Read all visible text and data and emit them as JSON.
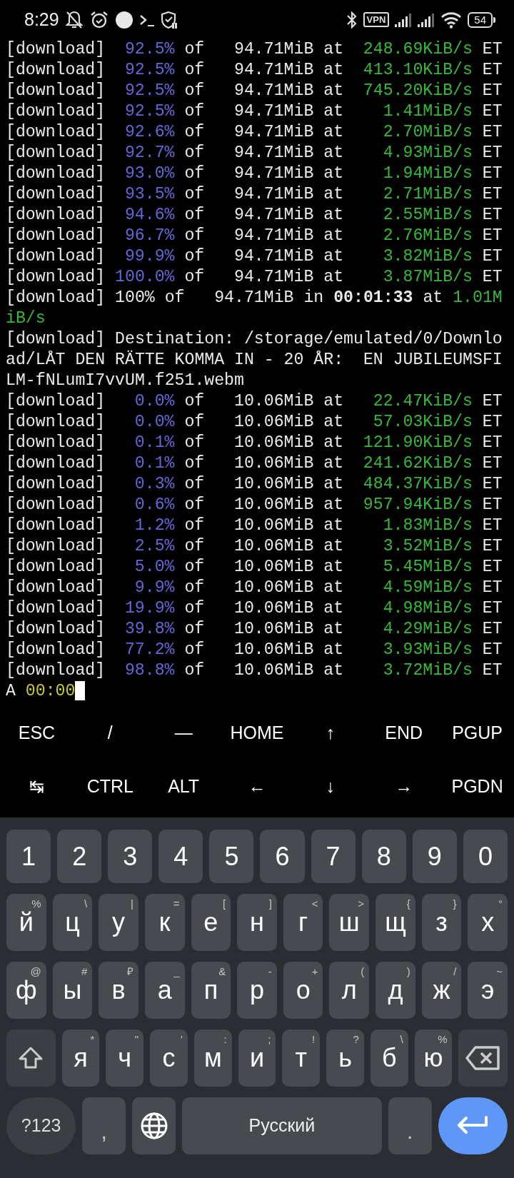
{
  "status_bar": {
    "time": "8:29",
    "vpn": "VPN",
    "battery": "54"
  },
  "terminal": {
    "lines": [
      {
        "kind": "progress",
        "tag": "[download]",
        "percent": "92.5%",
        "of": "of",
        "size": "94.71MiB",
        "at": "at",
        "speed": "248.69KiB/s",
        "eta": "ET"
      },
      {
        "kind": "progress",
        "tag": "[download]",
        "percent": "92.5%",
        "of": "of",
        "size": "94.71MiB",
        "at": "at",
        "speed": "413.10KiB/s",
        "eta": "ET"
      },
      {
        "kind": "progress",
        "tag": "[download]",
        "percent": "92.5%",
        "of": "of",
        "size": "94.71MiB",
        "at": "at",
        "speed": "745.20KiB/s",
        "eta": "ET"
      },
      {
        "kind": "progress",
        "tag": "[download]",
        "percent": "92.5%",
        "of": "of",
        "size": "94.71MiB",
        "at": "at",
        "speed": "1.41MiB/s",
        "eta": "ET"
      },
      {
        "kind": "progress",
        "tag": "[download]",
        "percent": "92.6%",
        "of": "of",
        "size": "94.71MiB",
        "at": "at",
        "speed": "2.70MiB/s",
        "eta": "ET"
      },
      {
        "kind": "progress",
        "tag": "[download]",
        "percent": "92.7%",
        "of": "of",
        "size": "94.71MiB",
        "at": "at",
        "speed": "4.93MiB/s",
        "eta": "ET"
      },
      {
        "kind": "progress",
        "tag": "[download]",
        "percent": "93.0%",
        "of": "of",
        "size": "94.71MiB",
        "at": "at",
        "speed": "1.94MiB/s",
        "eta": "ET"
      },
      {
        "kind": "progress",
        "tag": "[download]",
        "percent": "93.5%",
        "of": "of",
        "size": "94.71MiB",
        "at": "at",
        "speed": "2.71MiB/s",
        "eta": "ET"
      },
      {
        "kind": "progress",
        "tag": "[download]",
        "percent": "94.6%",
        "of": "of",
        "size": "94.71MiB",
        "at": "at",
        "speed": "2.55MiB/s",
        "eta": "ET"
      },
      {
        "kind": "progress",
        "tag": "[download]",
        "percent": "96.7%",
        "of": "of",
        "size": "94.71MiB",
        "at": "at",
        "speed": "2.76MiB/s",
        "eta": "ET"
      },
      {
        "kind": "progress",
        "tag": "[download]",
        "percent": "99.9%",
        "of": "of",
        "size": "94.71MiB",
        "at": "at",
        "speed": "3.82MiB/s",
        "eta": "ET"
      },
      {
        "kind": "progress",
        "tag": "[download]",
        "percent": "100.0%",
        "of": "of",
        "size": "94.71MiB",
        "at": "at",
        "speed": "3.87MiB/s",
        "eta": "ET"
      },
      {
        "kind": "text",
        "segments": [
          {
            "text": "[download] 100% of   94.71MiB in ",
            "kind": "text"
          },
          {
            "text": "00:01:33",
            "kind": "duration"
          },
          {
            "text": " at ",
            "kind": "text"
          },
          {
            "text": "1.01MiB/s",
            "kind": "speed"
          }
        ]
      },
      {
        "kind": "text",
        "segments": [
          {
            "text": "[download] Destination: /storage/emulated/0/Download/LÅT DEN RÄTTE KOMMA IN - 20 ÅR:  EN JUBILEUMSFILM-fNLumI7vvUM.f251.webm",
            "kind": "text"
          }
        ]
      },
      {
        "kind": "progress",
        "tag": "[download]",
        "percent": "0.0%",
        "of": "of",
        "size": "10.06MiB",
        "at": "at",
        "speed": "22.47KiB/s",
        "eta": "ET"
      },
      {
        "kind": "progress",
        "tag": "[download]",
        "percent": "0.0%",
        "of": "of",
        "size": "10.06MiB",
        "at": "at",
        "speed": "57.03KiB/s",
        "eta": "ET"
      },
      {
        "kind": "progress",
        "tag": "[download]",
        "percent": "0.1%",
        "of": "of",
        "size": "10.06MiB",
        "at": "at",
        "speed": "121.90KiB/s",
        "eta": "ET"
      },
      {
        "kind": "progress",
        "tag": "[download]",
        "percent": "0.1%",
        "of": "of",
        "size": "10.06MiB",
        "at": "at",
        "speed": "241.62KiB/s",
        "eta": "ET"
      },
      {
        "kind": "progress",
        "tag": "[download]",
        "percent": "0.3%",
        "of": "of",
        "size": "10.06MiB",
        "at": "at",
        "speed": "484.37KiB/s",
        "eta": "ET"
      },
      {
        "kind": "progress",
        "tag": "[download]",
        "percent": "0.6%",
        "of": "of",
        "size": "10.06MiB",
        "at": "at",
        "speed": "957.94KiB/s",
        "eta": "ET"
      },
      {
        "kind": "progress",
        "tag": "[download]",
        "percent": "1.2%",
        "of": "of",
        "size": "10.06MiB",
        "at": "at",
        "speed": "1.83MiB/s",
        "eta": "ET"
      },
      {
        "kind": "progress",
        "tag": "[download]",
        "percent": "2.5%",
        "of": "of",
        "size": "10.06MiB",
        "at": "at",
        "speed": "3.52MiB/s",
        "eta": "ET"
      },
      {
        "kind": "progress",
        "tag": "[download]",
        "percent": "5.0%",
        "of": "of",
        "size": "10.06MiB",
        "at": "at",
        "speed": "5.45MiB/s",
        "eta": "ET"
      },
      {
        "kind": "progress",
        "tag": "[download]",
        "percent": "9.9%",
        "of": "of",
        "size": "10.06MiB",
        "at": "at",
        "speed": "4.59MiB/s",
        "eta": "ET"
      },
      {
        "kind": "progress",
        "tag": "[download]",
        "percent": "19.9%",
        "of": "of",
        "size": "10.06MiB",
        "at": "at",
        "speed": "4.98MiB/s",
        "eta": "ET"
      },
      {
        "kind": "progress",
        "tag": "[download]",
        "percent": "39.8%",
        "of": "of",
        "size": "10.06MiB",
        "at": "at",
        "speed": "4.29MiB/s",
        "eta": "ET"
      },
      {
        "kind": "progress",
        "tag": "[download]",
        "percent": "77.2%",
        "of": "of",
        "size": "10.06MiB",
        "at": "at",
        "speed": "3.93MiB/s",
        "eta": "ET"
      },
      {
        "kind": "progress",
        "tag": "[download]",
        "percent": "98.8%",
        "of": "of",
        "size": "10.06MiB",
        "at": "at",
        "speed": "3.72MiB/s",
        "eta": "ET"
      },
      {
        "kind": "text",
        "cursor": true,
        "segments": [
          {
            "text": "A ",
            "kind": "text"
          },
          {
            "text": "00:00",
            "kind": "timer"
          }
        ]
      }
    ]
  },
  "extra_keys": [
    [
      "ESC",
      "/",
      "—",
      "HOME",
      "↑",
      "END",
      "PGUP"
    ],
    [
      "↹",
      "CTRL",
      "ALT",
      "←",
      "↓",
      "→",
      "PGDN"
    ]
  ],
  "keyboard": {
    "rows": [
      {
        "keys": [
          {
            "kind": "char",
            "label": "1"
          },
          {
            "kind": "char",
            "label": "2"
          },
          {
            "kind": "char",
            "label": "3"
          },
          {
            "kind": "char",
            "label": "4"
          },
          {
            "kind": "char",
            "label": "5"
          },
          {
            "kind": "char",
            "label": "6"
          },
          {
            "kind": "char",
            "label": "7"
          },
          {
            "kind": "char",
            "label": "8"
          },
          {
            "kind": "char",
            "label": "9"
          },
          {
            "kind": "char",
            "label": "0"
          }
        ]
      },
      {
        "keys": [
          {
            "kind": "char",
            "label": "й",
            "hint": "%"
          },
          {
            "kind": "char",
            "label": "ц",
            "hint": "\\"
          },
          {
            "kind": "char",
            "label": "у",
            "hint": "|"
          },
          {
            "kind": "char",
            "label": "к",
            "hint": "="
          },
          {
            "kind": "char",
            "label": "е",
            "hint": "["
          },
          {
            "kind": "char",
            "label": "н",
            "hint": "]"
          },
          {
            "kind": "char",
            "label": "г",
            "hint": "<"
          },
          {
            "kind": "char",
            "label": "ш",
            "hint": ">"
          },
          {
            "kind": "char",
            "label": "щ",
            "hint": "{"
          },
          {
            "kind": "char",
            "label": "з",
            "hint": "}"
          },
          {
            "kind": "char",
            "label": "х",
            "hint": "°"
          }
        ]
      },
      {
        "keys": [
          {
            "kind": "char",
            "label": "ф",
            "hint": "@"
          },
          {
            "kind": "char",
            "label": "ы",
            "hint": "#"
          },
          {
            "kind": "char",
            "label": "в",
            "hint": "₽"
          },
          {
            "kind": "char",
            "label": "а",
            "hint": "_"
          },
          {
            "kind": "char",
            "label": "п",
            "hint": "&"
          },
          {
            "kind": "char",
            "label": "р",
            "hint": "-"
          },
          {
            "kind": "char",
            "label": "о",
            "hint": "+"
          },
          {
            "kind": "char",
            "label": "л",
            "hint": "("
          },
          {
            "kind": "char",
            "label": "д",
            "hint": ")"
          },
          {
            "kind": "char",
            "label": "ж",
            "hint": "/"
          },
          {
            "kind": "char",
            "label": "э",
            "hint": "~"
          }
        ]
      },
      {
        "keys": [
          {
            "kind": "shift"
          },
          {
            "kind": "char",
            "label": "я",
            "hint": "*"
          },
          {
            "kind": "char",
            "label": "ч",
            "hint": "\""
          },
          {
            "kind": "char",
            "label": "с",
            "hint": "'"
          },
          {
            "kind": "char",
            "label": "м",
            "hint": ":"
          },
          {
            "kind": "char",
            "label": "и",
            "hint": ";"
          },
          {
            "kind": "char",
            "label": "т",
            "hint": "!"
          },
          {
            "kind": "char",
            "label": "ь",
            "hint": "?"
          },
          {
            "kind": "char",
            "label": "б",
            "hint": "\\"
          },
          {
            "kind": "char",
            "label": "ю",
            "hint": "%"
          },
          {
            "kind": "backspace"
          }
        ]
      },
      {
        "keys": [
          {
            "kind": "symbols",
            "label": "?123"
          },
          {
            "kind": "punct",
            "label": ","
          },
          {
            "kind": "globe"
          },
          {
            "kind": "space",
            "label": "Русский"
          },
          {
            "kind": "punct",
            "label": "."
          },
          {
            "kind": "enter"
          }
        ]
      }
    ]
  }
}
